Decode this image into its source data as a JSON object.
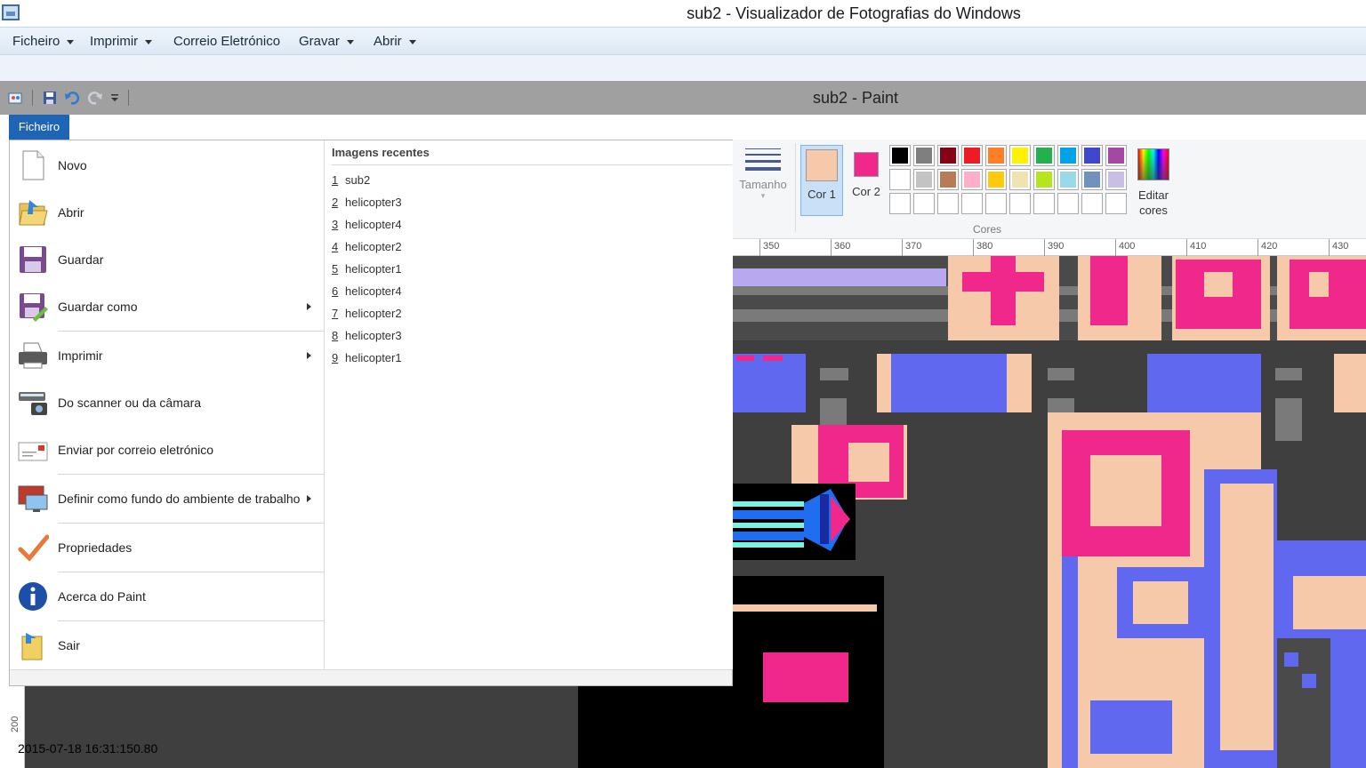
{
  "photo_viewer": {
    "title": "sub2 - Visualizador de Fotografias do Windows",
    "menus": [
      "Ficheiro",
      "Imprimir",
      "Correio Eletrónico",
      "Gravar",
      "Abrir"
    ]
  },
  "paint": {
    "title": "sub2 - Paint",
    "file_tab": "Ficheiro",
    "ribbon": {
      "size_label": "Tamanho",
      "color1_label": "Cor 1",
      "color2_label": "Cor 2",
      "color1": "#f6c9aa",
      "color2": "#f0288c",
      "edit_colors_label": "Editar cores",
      "group_label": "Cores",
      "palette_row1": [
        "#000000",
        "#7f7f7f",
        "#880015",
        "#ed1c24",
        "#ff7f27",
        "#fff200",
        "#22b14c",
        "#00a2e8",
        "#3f48cc",
        "#a349a4"
      ],
      "palette_row2": [
        "#ffffff",
        "#c3c3c3",
        "#b97a57",
        "#ffaec9",
        "#ffc90e",
        "#efe4b0",
        "#b5e61d",
        "#99d9ea",
        "#7092be",
        "#c8bfe7"
      ]
    },
    "ruler_labels": [
      "350",
      "360",
      "370",
      "380",
      "390",
      "400",
      "410",
      "420",
      "430"
    ],
    "vruler_label": "200",
    "file_menu": {
      "items": [
        {
          "label": "Novo",
          "icon": "new-document-icon",
          "submenu": false
        },
        {
          "label": "Abrir",
          "icon": "open-folder-icon",
          "submenu": false
        },
        {
          "label": "Guardar",
          "icon": "floppy-save-icon",
          "submenu": false
        },
        {
          "label": "Guardar como",
          "icon": "save-as-icon",
          "submenu": true
        },
        {
          "label": "Imprimir",
          "icon": "printer-icon",
          "submenu": true
        },
        {
          "label": "Do scanner ou da câmara",
          "icon": "scanner-camera-icon",
          "submenu": false
        },
        {
          "label": "Enviar por correio eletrónico",
          "icon": "email-icon",
          "submenu": false
        },
        {
          "label": "Definir como fundo do ambiente de trabalho",
          "icon": "desktop-background-icon",
          "submenu": true
        },
        {
          "label": "Propriedades",
          "icon": "checkmark-properties-icon",
          "submenu": false
        },
        {
          "label": "Acerca do Paint",
          "icon": "info-icon",
          "submenu": false
        },
        {
          "label": "Sair",
          "icon": "exit-icon",
          "submenu": false
        }
      ],
      "recent_heading": "Imagens recentes",
      "recent": [
        {
          "num": "1",
          "name": "sub2"
        },
        {
          "num": "2",
          "name": "helicopter3"
        },
        {
          "num": "3",
          "name": "helicopter4"
        },
        {
          "num": "4",
          "name": "helicopter2"
        },
        {
          "num": "5",
          "name": "helicopter1"
        },
        {
          "num": "6",
          "name": "helicopter4"
        },
        {
          "num": "7",
          "name": "helicopter2"
        },
        {
          "num": "8",
          "name": "helicopter3"
        },
        {
          "num": "9",
          "name": "helicopter1"
        }
      ]
    }
  },
  "timestamp": "2015-07-18 16:31:150.80"
}
